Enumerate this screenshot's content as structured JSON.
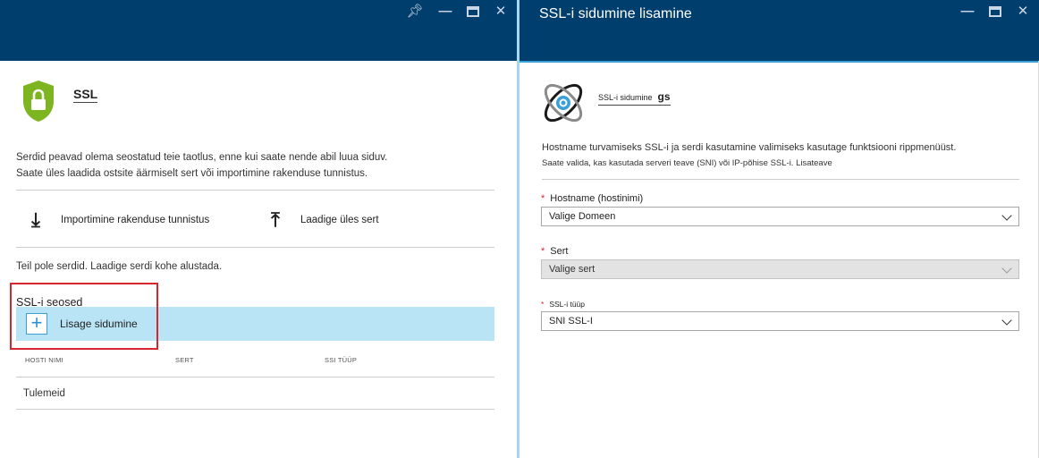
{
  "left_blade": {
    "title": "SSL",
    "description_line1": "Serdid peavad olema seostatud teie taotlus, enne kui saate nende abil luua siduv.",
    "description_line2": "Saate üles laadida ostsite äärmiselt sert või importimine rakenduse tunnistus.",
    "import_label": "Importimine rakenduse tunnistus",
    "upload_label": "Laadige üles sert",
    "no_certs": "Teil pole serdid. Laadige serdi kohe alustada.",
    "bindings_title": "SSL-i seosed",
    "add_binding_label": "Lisage sidumine",
    "columns": [
      "HOSTI NIMI",
      "SERT",
      "SSI TÜÜP"
    ],
    "no_results": "Tulemeid",
    "header_icons": [
      "pin-icon",
      "minimize-icon",
      "maximize-icon",
      "close-icon"
    ]
  },
  "right_blade": {
    "title": "SSL-i sidumine lisamine",
    "binding_name_small": "SSL-i sidumine",
    "binding_name_bold": "gs",
    "description_line1": "Hostname turvamiseks SSL-i ja serdi kasutamine valimiseks kasutage funktsiooni rippmenüüst.",
    "description_line2": "Saate valida, kas kasutada serveri teave (SNI) või IP-põhise SSL-i. Lisateave",
    "hostname_label": "Hostname (hostinimi)",
    "hostname_value": "Valige Domeen",
    "cert_label": "Sert",
    "cert_value": "Valige sert",
    "ssl_type_label": "SSL-i tüüp",
    "ssl_type_value": "SNI SSL-I",
    "required_marker": "*",
    "header_icons": [
      "minimize-icon",
      "maximize-icon",
      "close-icon"
    ]
  },
  "colors": {
    "header_bg": "#003e6e",
    "accent": "#3aa0d8",
    "add_row_bg": "#b8e4f6",
    "highlight": "#d9262e",
    "shield": "#7cb51f"
  }
}
